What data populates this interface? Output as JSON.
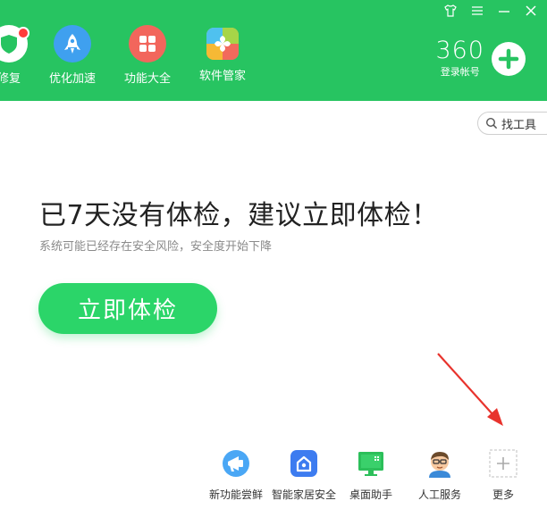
{
  "window": {
    "skin_icon": "tshirt-icon",
    "menu_icon": "menu-icon",
    "minimize_icon": "minimize-icon",
    "close_icon": "close-icon"
  },
  "nav": {
    "items": [
      {
        "label": "修复",
        "icon": "shield-icon",
        "color": "#27c461"
      },
      {
        "label": "优化加速",
        "icon": "rocket-icon",
        "color": "#3fa0ef"
      },
      {
        "label": "功能大全",
        "icon": "grid-icon",
        "color": "#f2665c"
      },
      {
        "label": "软件管家",
        "icon": "software-manager-icon",
        "color": "#f6b935"
      }
    ]
  },
  "account": {
    "logo": "360",
    "login_label": "登录帐号"
  },
  "search": {
    "label": "找工具"
  },
  "main": {
    "headline": "已7天没有体检，建议立即体检！",
    "subline": "系统可能已经存在安全风险，安全度开始下降",
    "check_button": "立即体检"
  },
  "bottom": {
    "items": [
      {
        "label": "新功能尝鲜",
        "icon": "megaphone-icon"
      },
      {
        "label": "智能家居安全",
        "icon": "smart-home-icon"
      },
      {
        "label": "桌面助手",
        "icon": "desktop-monitor-icon"
      },
      {
        "label": "人工服务",
        "icon": "support-person-icon"
      },
      {
        "label": "更多",
        "icon": "plus-icon"
      }
    ]
  },
  "colors": {
    "header": "#27c461",
    "button": "#2bd569",
    "arrow": "#e8332d"
  }
}
